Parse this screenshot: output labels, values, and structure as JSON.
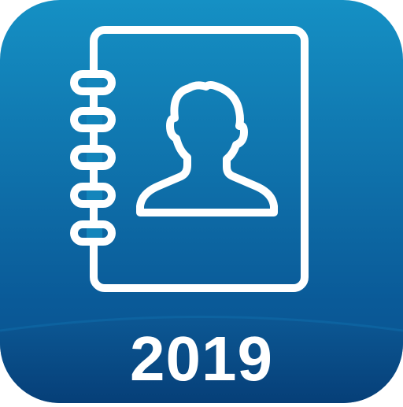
{
  "icon": {
    "name": "contacts-address-book-icon",
    "year": "2019",
    "colors": {
      "background_top": "#1590c4",
      "background_bottom": "#0a5a98",
      "band_top": "#0c5894",
      "band_bottom": "#063f78",
      "line": "#ffffff",
      "text": "#ffffff"
    }
  }
}
